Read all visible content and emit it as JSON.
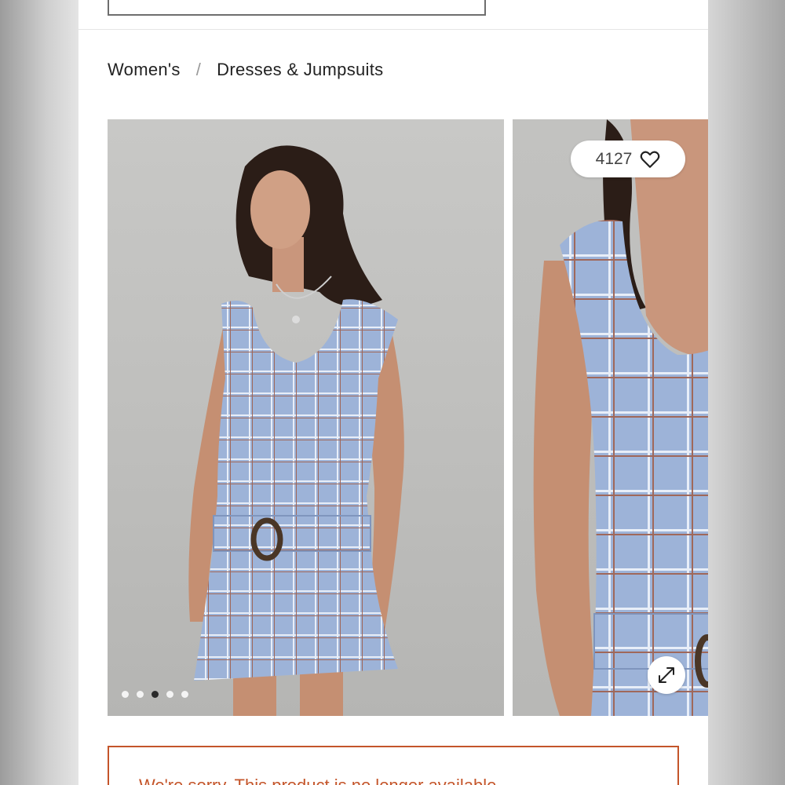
{
  "header": {
    "search_placeholder": ""
  },
  "breadcrumb": {
    "items": [
      {
        "label": "Women's"
      },
      {
        "label": "Dresses & Jumpsuits"
      }
    ],
    "separator": "/"
  },
  "gallery": {
    "likes_count": "4127",
    "dots_total": 5,
    "dots_active_index": 2,
    "expand_icon": "expand-arrows-icon",
    "like_icon": "heart-outline-icon"
  },
  "notice": {
    "message": "We're sorry. This product is no longer available."
  },
  "colors": {
    "accent": "#c4552a",
    "dress": "#9db3d8"
  }
}
